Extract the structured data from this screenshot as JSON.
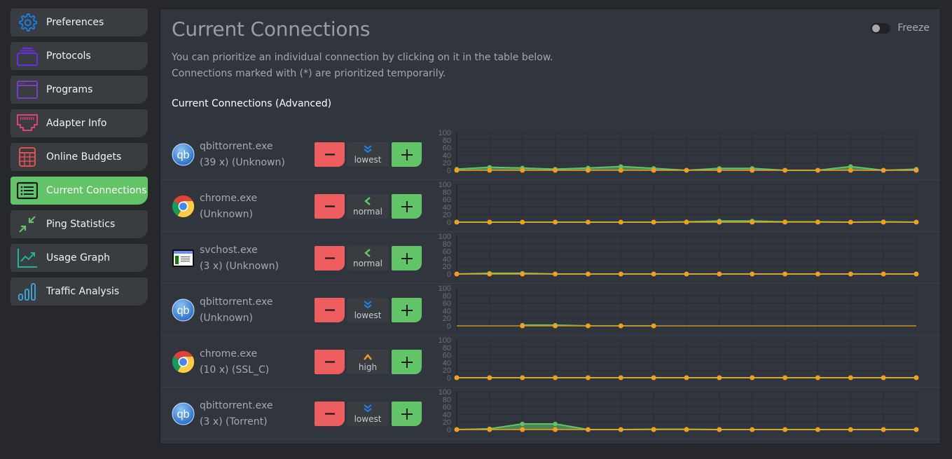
{
  "sidebar": {
    "items": [
      {
        "label": "Preferences",
        "icon": "gear-icon",
        "color": "#1e7bdc",
        "active": false
      },
      {
        "label": "Protocols",
        "icon": "stack-icon",
        "color": "#6a2ee0",
        "active": false
      },
      {
        "label": "Programs",
        "icon": "window-icon",
        "color": "#7b3fbf",
        "active": false
      },
      {
        "label": "Adapter Info",
        "icon": "ethernet-port-icon",
        "color": "#e0407a",
        "active": false
      },
      {
        "label": "Online Budgets",
        "icon": "calculator-icon",
        "color": "#e05050",
        "active": false
      },
      {
        "label": "Current Connections",
        "icon": "list-icon",
        "color": "#111111",
        "active": true
      },
      {
        "label": "Ping Statistics",
        "icon": "compress-arrows-icon",
        "color": "#62c466",
        "active": false
      },
      {
        "label": "Usage Graph",
        "icon": "line-chart-icon",
        "color": "#20b58a",
        "active": false
      },
      {
        "label": "Traffic Analysis",
        "icon": "bar-chart-icon",
        "color": "#3aa0d0",
        "active": false
      }
    ]
  },
  "main": {
    "title": "Current Connections",
    "freeze_label": "Freeze",
    "freeze_on": false,
    "description_line1": "You can prioritize an individual connection by clicking on it in the table below.",
    "description_line2": "Connections marked with (*) are prioritized temporarily.",
    "section_title": "Current Connections (Advanced)",
    "minus_label": "−",
    "plus_label": "+",
    "connections": [
      {
        "app": "qbittorrent.exe",
        "detail": "(39 x) (Unknown)",
        "icon": "qbittorrent-icon",
        "priority": "lowest",
        "priority_icon": "double-chevron-down-icon"
      },
      {
        "app": "chrome.exe",
        "detail": "(Unknown)",
        "icon": "chrome-icon",
        "priority": "normal",
        "priority_icon": "chevron-left-icon"
      },
      {
        "app": "svchost.exe",
        "detail": "(3 x) (Unknown)",
        "icon": "svchost-window-icon",
        "priority": "normal",
        "priority_icon": "chevron-left-icon"
      },
      {
        "app": "qbittorrent.exe",
        "detail": "(Unknown)",
        "icon": "qbittorrent-icon",
        "priority": "lowest",
        "priority_icon": "double-chevron-down-icon"
      },
      {
        "app": "chrome.exe",
        "detail": "(10 x) (SSL_C)",
        "icon": "chrome-icon",
        "priority": "high",
        "priority_icon": "chevron-up-icon"
      },
      {
        "app": "qbittorrent.exe",
        "detail": "(3 x) (Torrent)",
        "icon": "qbittorrent-icon",
        "priority": "lowest",
        "priority_icon": "double-chevron-down-icon"
      }
    ]
  },
  "colors": {
    "priority_lowest": "#1f86f0",
    "priority_normal": "#62c466",
    "priority_high": "#f0a020",
    "series_green": "#62c466",
    "series_orange": "#f0a020"
  },
  "chart_data": [
    {
      "type": "area",
      "yticks": [
        0,
        20,
        40,
        60,
        80,
        100
      ],
      "ylim": [
        0,
        100
      ],
      "x_count": 15,
      "series": [
        {
          "name": "green",
          "values": [
            3,
            8,
            6,
            3,
            6,
            10,
            5,
            0,
            5,
            5,
            0,
            0,
            10,
            0,
            3
          ]
        },
        {
          "name": "orange",
          "values": [
            0,
            0,
            0,
            0,
            0,
            0,
            0,
            0,
            0,
            0,
            0,
            0,
            0,
            0,
            0
          ]
        }
      ]
    },
    {
      "type": "area",
      "yticks": [
        0,
        20,
        40,
        60,
        80,
        100
      ],
      "ylim": [
        0,
        100
      ],
      "x_count": 15,
      "series": [
        {
          "name": "green",
          "values": [
            0,
            0,
            0,
            0,
            0,
            0,
            0,
            1,
            3,
            3,
            1,
            1,
            0,
            1,
            0
          ]
        },
        {
          "name": "orange",
          "values": [
            0,
            0,
            0,
            0,
            0,
            0,
            0,
            0,
            0,
            0,
            0,
            0,
            0,
            0,
            0
          ]
        }
      ]
    },
    {
      "type": "area",
      "yticks": [
        0,
        20,
        40,
        60,
        80,
        100
      ],
      "ylim": [
        0,
        100
      ],
      "x_count": 15,
      "series": [
        {
          "name": "green",
          "values": [
            0,
            2,
            2,
            0,
            0,
            0,
            0,
            0,
            0,
            0,
            0,
            0,
            0,
            0,
            0
          ]
        },
        {
          "name": "orange",
          "values": [
            0,
            0,
            0,
            0,
            0,
            0,
            0,
            0,
            0,
            0,
            0,
            0,
            0,
            0,
            0
          ]
        }
      ]
    },
    {
      "type": "area",
      "yticks": [
        0,
        20,
        40,
        60,
        80,
        100
      ],
      "ylim": [
        0,
        100
      ],
      "x_count": 15,
      "series": [
        {
          "name": "green",
          "values": [
            null,
            null,
            2,
            2,
            0,
            0,
            0,
            null,
            null,
            null,
            null,
            null,
            null,
            null,
            null
          ]
        },
        {
          "name": "orange",
          "values": [
            null,
            null,
            0,
            0,
            0,
            0,
            0,
            null,
            null,
            null,
            null,
            null,
            null,
            null,
            null
          ]
        }
      ]
    },
    {
      "type": "area",
      "yticks": [
        0,
        20,
        40,
        60,
        80,
        100
      ],
      "ylim": [
        0,
        100
      ],
      "x_count": 15,
      "series": [
        {
          "name": "green",
          "values": [
            0,
            0,
            0,
            0,
            0,
            0,
            0,
            0,
            0,
            0,
            0,
            0,
            0,
            0,
            0
          ]
        },
        {
          "name": "orange",
          "values": [
            0,
            0,
            0,
            0,
            0,
            0,
            0,
            0,
            0,
            0,
            0,
            0,
            0,
            0,
            0
          ]
        }
      ]
    },
    {
      "type": "area",
      "yticks": [
        0,
        20,
        40,
        60,
        80,
        100
      ],
      "ylim": [
        0,
        100
      ],
      "x_count": 15,
      "series": [
        {
          "name": "green",
          "values": [
            0,
            2,
            15,
            15,
            0,
            0,
            1,
            1,
            0,
            0,
            0,
            0,
            0,
            0,
            0
          ]
        },
        {
          "name": "orange",
          "values": [
            0,
            0,
            0,
            0,
            0,
            0,
            0,
            0,
            0,
            0,
            0,
            0,
            0,
            0,
            0
          ]
        }
      ]
    }
  ]
}
